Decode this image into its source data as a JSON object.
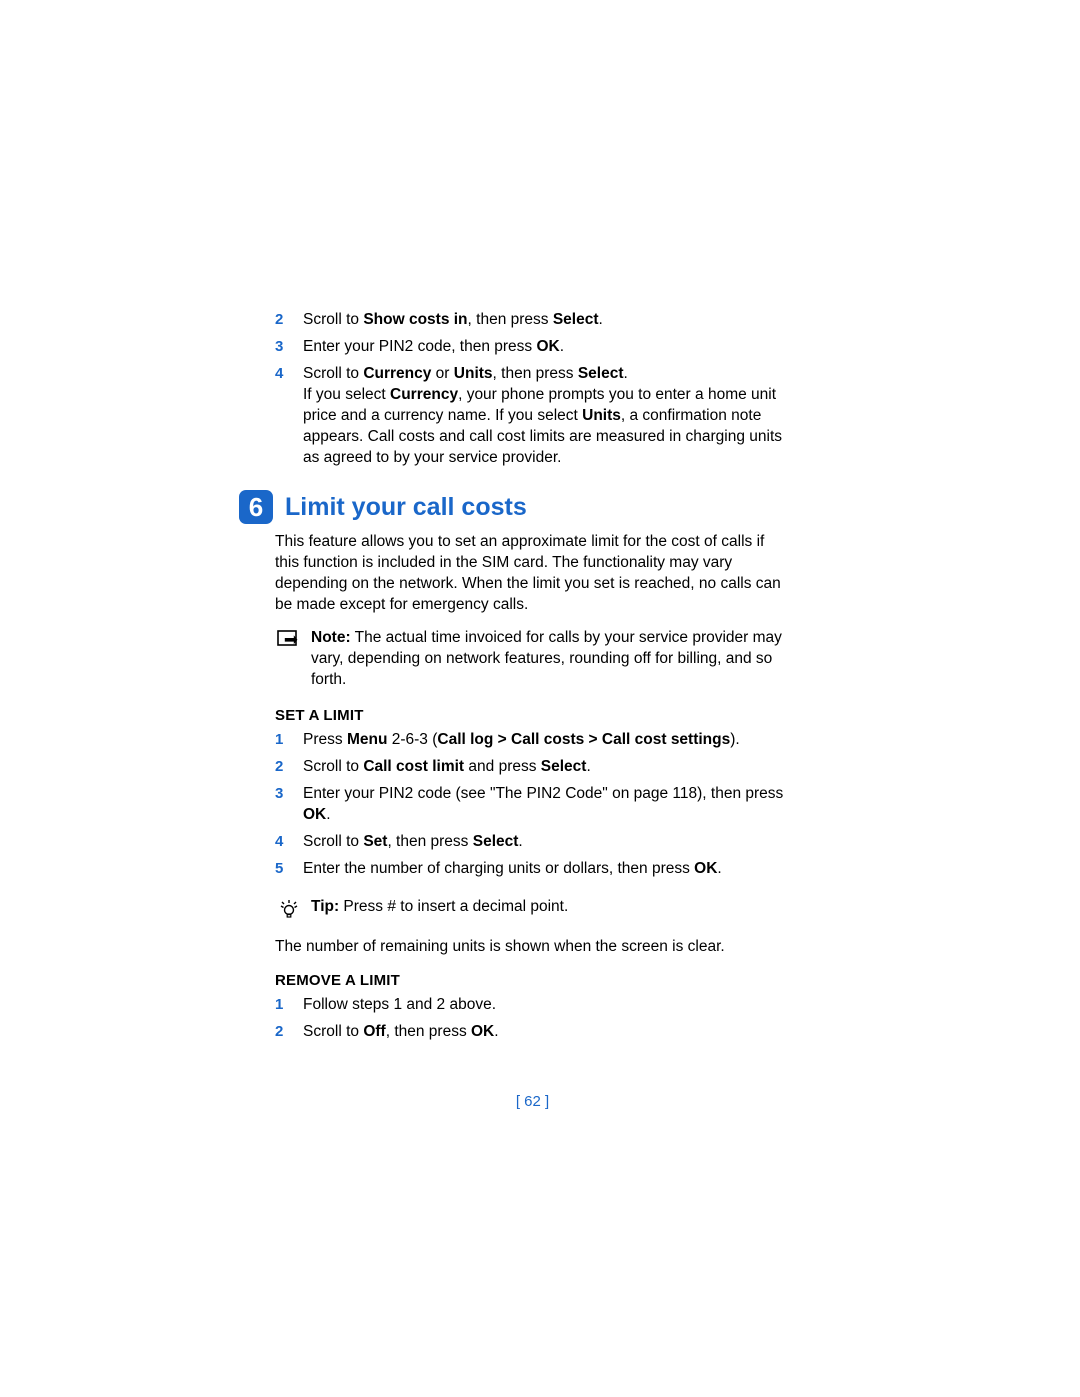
{
  "top_steps": [
    {
      "num": "2",
      "parts": [
        {
          "t": "Scroll to "
        },
        {
          "t": "Show costs in",
          "b": true
        },
        {
          "t": ", then press "
        },
        {
          "t": "Select",
          "b": true
        },
        {
          "t": "."
        }
      ]
    },
    {
      "num": "3",
      "parts": [
        {
          "t": "Enter your PIN2 code, then press "
        },
        {
          "t": "OK",
          "b": true
        },
        {
          "t": "."
        }
      ]
    },
    {
      "num": "4",
      "parts": [
        {
          "t": "Scroll to "
        },
        {
          "t": "Currency",
          "b": true
        },
        {
          "t": " or "
        },
        {
          "t": "Units",
          "b": true
        },
        {
          "t": ", then press "
        },
        {
          "t": "Select",
          "b": true
        },
        {
          "t": "."
        }
      ],
      "cont": [
        {
          "t": "If you select "
        },
        {
          "t": "Currency",
          "b": true
        },
        {
          "t": ", your phone prompts you to enter a home unit price and a currency name. If you select "
        },
        {
          "t": "Units",
          "b": true
        },
        {
          "t": ", a confirmation note appears. Call costs and call cost limits are measured in charging units as agreed to by your service provider."
        }
      ]
    }
  ],
  "section": {
    "num": "6",
    "title": "Limit your call costs"
  },
  "section_intro": "This feature allows you to set an approximate limit for the cost of calls if this function is included in the SIM card. The functionality may vary depending on the network. When the limit you set is reached, no calls can be made except for emergency calls.",
  "note": {
    "label": "Note:",
    "text": " The actual time invoiced for calls by your service provider may vary, depending on network features, rounding off for billing, and so forth."
  },
  "set_limit": {
    "heading": "SET A LIMIT",
    "steps": [
      {
        "num": "1",
        "parts": [
          {
            "t": "Press "
          },
          {
            "t": "Menu",
            "b": true
          },
          {
            "t": " 2-6-3 ("
          },
          {
            "t": "Call log > Call costs > Call cost settings",
            "b": true
          },
          {
            "t": ")."
          }
        ]
      },
      {
        "num": "2",
        "parts": [
          {
            "t": "Scroll to "
          },
          {
            "t": "Call cost limit",
            "b": true
          },
          {
            "t": " and press "
          },
          {
            "t": "Select",
            "b": true
          },
          {
            "t": "."
          }
        ]
      },
      {
        "num": "3",
        "parts": [
          {
            "t": "Enter your PIN2 code (see \"The PIN2 Code\" on page 118), then press "
          },
          {
            "t": "OK",
            "b": true
          },
          {
            "t": "."
          }
        ]
      },
      {
        "num": "4",
        "parts": [
          {
            "t": "Scroll to "
          },
          {
            "t": "Set",
            "b": true
          },
          {
            "t": ", then press "
          },
          {
            "t": "Select",
            "b": true
          },
          {
            "t": "."
          }
        ]
      },
      {
        "num": "5",
        "parts": [
          {
            "t": "Enter the number of charging units or dollars, then press "
          },
          {
            "t": "OK",
            "b": true
          },
          {
            "t": "."
          }
        ]
      }
    ],
    "tip": {
      "label": "Tip:",
      "text": " Press # to insert a decimal point."
    },
    "after_tip": "The number of remaining units is shown when the screen is clear."
  },
  "remove_limit": {
    "heading": "REMOVE A LIMIT",
    "steps": [
      {
        "num": "1",
        "parts": [
          {
            "t": "Follow steps 1 and 2 above."
          }
        ]
      },
      {
        "num": "2",
        "parts": [
          {
            "t": "Scroll to "
          },
          {
            "t": "Off",
            "b": true
          },
          {
            "t": ", then press "
          },
          {
            "t": "OK",
            "b": true
          },
          {
            "t": "."
          }
        ]
      }
    ]
  },
  "page_number": "[ 62 ]"
}
